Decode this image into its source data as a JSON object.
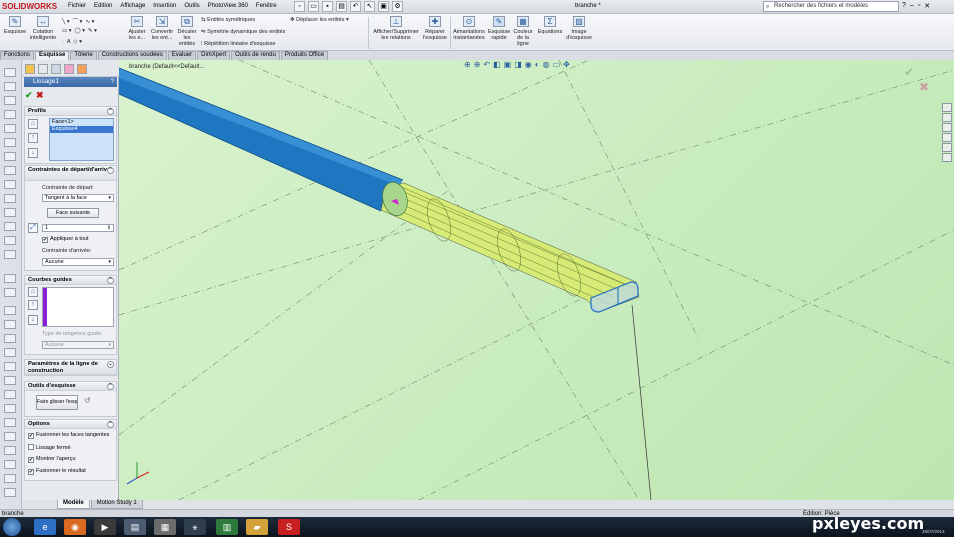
{
  "app": {
    "logo": "SOLIDWORKS",
    "doc_title": "branche *",
    "menu": [
      "Fichier",
      "Edition",
      "Affichage",
      "Insertion",
      "Outils",
      "PhotoView 360",
      "Fenêtre"
    ],
    "search_placeholder": "Rechercher des fichiers et modèles"
  },
  "ribbon": {
    "esquisse": "Esquisse",
    "cotation": "Cotation intelligente",
    "ajuster": "Ajuster les e...",
    "convertir": "Convertir les ent...",
    "decaler": "Décaler les entités",
    "entites_symetriques": "Entités symétriques",
    "symetrie_dynamique": "Symétrie dynamique des entités",
    "repetition": "Répétition linéaire d'esquisse",
    "deplacer": "Déplacer les entités",
    "afficher_relations": "Afficher/Supprimer les relations",
    "reparer": "Réparer l'esquisse",
    "aimantations": "Aimantations instantanées",
    "esquisse_rapide": "Esquisse rapide",
    "couleur_ligne": "Couleur de la ligne",
    "equations": "Equations",
    "image_esquisse": "Image d'esquisse"
  },
  "tabs": [
    "Fonctions",
    "Esquisse",
    "Tôlerie",
    "Constructions soudées",
    "Evaluer",
    "DimXpert",
    "Outils de rendu",
    "Produits Office"
  ],
  "pm": {
    "title": "Lissage1",
    "help": "?",
    "ok": "✔",
    "cancel": "✖",
    "profile": {
      "title": "Profils",
      "items": [
        "Face<1>",
        "Esquisse4"
      ]
    },
    "constraints": {
      "title": "Contraintes de départ/d'arrivée",
      "start_label": "Contrainte de départ:",
      "start_value": "Tangent à la face",
      "next_face": "Face suivante",
      "value": "1",
      "apply_all": "Appliquer à tout",
      "end_label": "Contrainte d'arrivée:",
      "end_value": "Aucune"
    },
    "guides": {
      "title": "Courbes guides",
      "tangency_label": "Type de tangence guide:",
      "tangency_value": "Aucune"
    },
    "centerline": {
      "title": "Paramètres de la ligne de construction"
    },
    "sketch_tools": {
      "title": "Outils d'esquisse",
      "drag": "Faire glisser l'esquisse"
    },
    "options": {
      "title": "Options",
      "items": [
        {
          "label": "Fusionner les faces tangentes",
          "checked": true
        },
        {
          "label": "Lissage fermé",
          "checked": false
        },
        {
          "label": "Montrer l'aperçu",
          "checked": true
        },
        {
          "label": "Fusionner le résultat",
          "checked": true
        }
      ]
    }
  },
  "viewport": {
    "tree_label": "branche (Default<<Default..."
  },
  "bottom_tabs": [
    "Modèle",
    "Motion Study 1"
  ],
  "status": {
    "left": "branche",
    "right": "Edition: Pièce"
  },
  "taskbar": {
    "watermark": "pxleyes.com",
    "clock": "28/07/2013"
  }
}
